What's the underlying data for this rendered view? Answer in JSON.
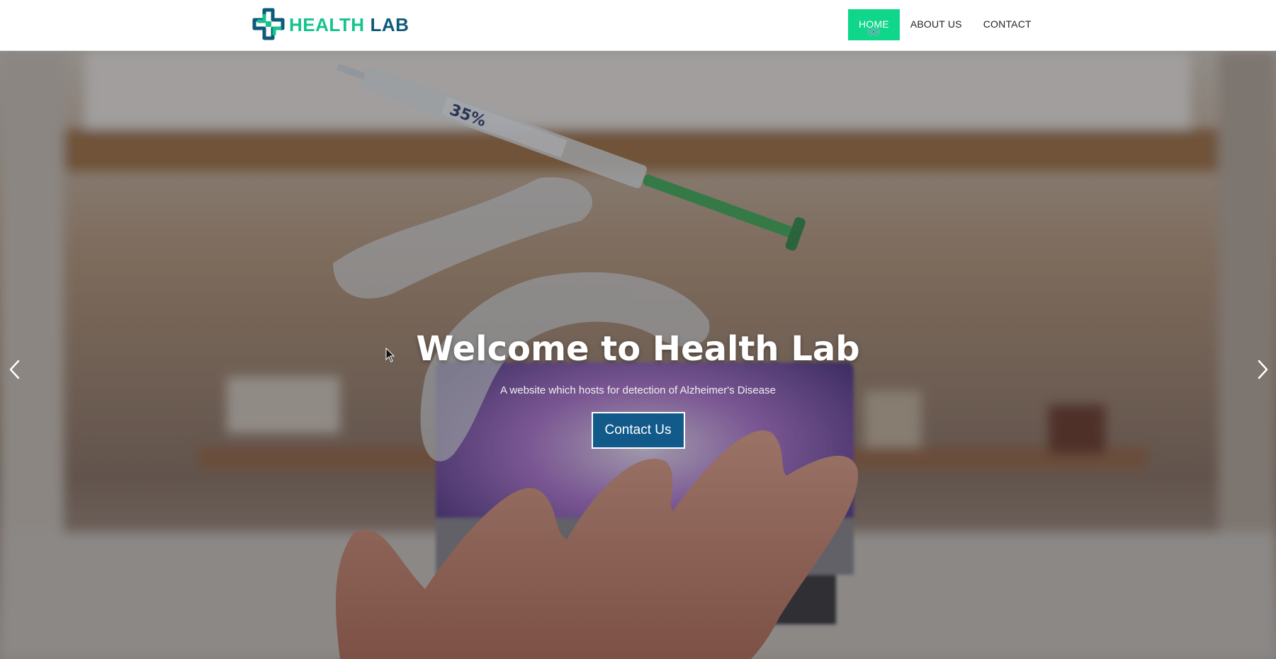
{
  "brand": {
    "name_part1": "HEALTH",
    "name_part2": "LAB",
    "logo_icon": "medical-cross-icon",
    "color_primary": "#14c38e",
    "color_secondary": "#0e5a7a"
  },
  "nav": {
    "items": [
      {
        "label": "HOME",
        "active": true
      },
      {
        "label": "ABOUT US",
        "active": false
      },
      {
        "label": "CONTACT",
        "active": false
      }
    ],
    "active_color": "#0fd68b"
  },
  "hero": {
    "title": "Welcome to Health Lab",
    "subtitle": "A website which hosts for detection of Alzheimer's Disease",
    "cta_label": "Contact Us",
    "cta_color": "#125a8a",
    "prev_icon": "chevron-left-icon",
    "next_icon": "chevron-right-icon"
  }
}
